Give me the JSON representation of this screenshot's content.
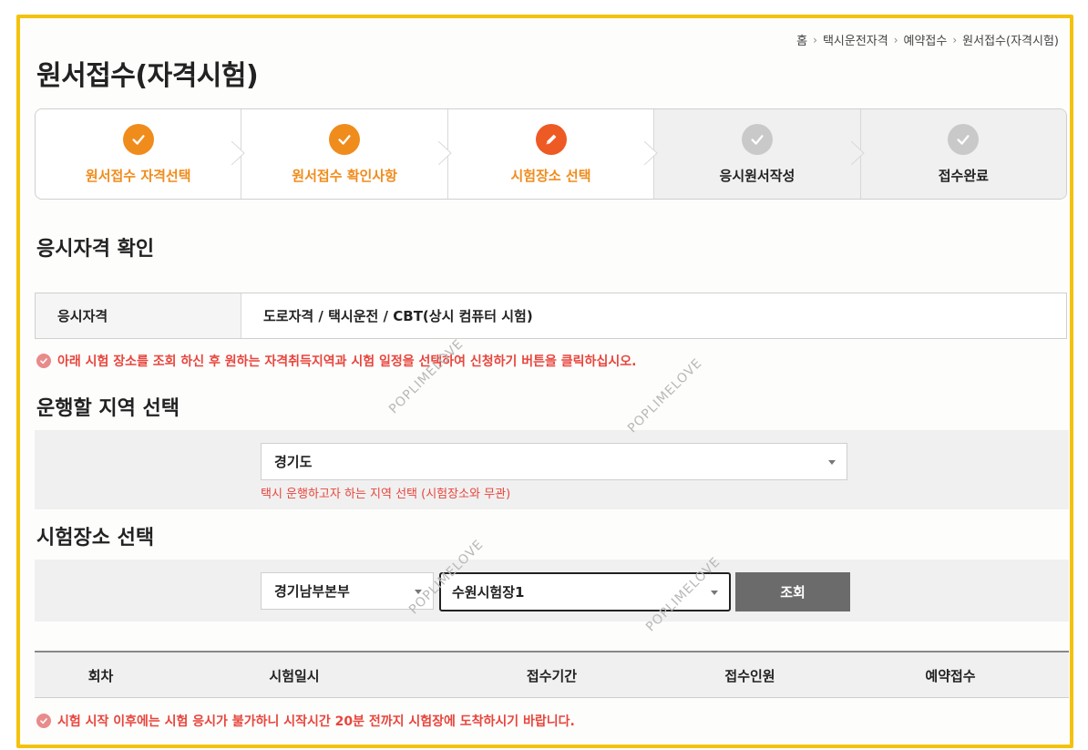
{
  "breadcrumb": [
    "홈",
    "택시운전자격",
    "예약접수",
    "원서접수(자격시험)"
  ],
  "page_title": "원서접수(자격시험)",
  "steps": [
    {
      "label": "원서접수 자격선택",
      "state": "done",
      "icon": "check-icon"
    },
    {
      "label": "원서접수 확인사항",
      "state": "done",
      "icon": "check-icon"
    },
    {
      "label": "시험장소 선택",
      "state": "current",
      "icon": "pencil-icon"
    },
    {
      "label": "응시원서작성",
      "state": "pending",
      "icon": "check-icon"
    },
    {
      "label": "접수완료",
      "state": "pending",
      "icon": "check-icon"
    }
  ],
  "qualification": {
    "section_title": "응시자격 확인",
    "header": "응시자격",
    "value": "도로자격 / 택시운전 / CBT(상시 컴퓨터 시험)"
  },
  "notice_1": "아래 시험 장소를 조회 하신 후 원하는 자격취득지역과 시험 일정을 선택하여 신청하기 버튼을 클릭하십시오.",
  "region": {
    "section_title": "운행할 지역 선택",
    "selected": "경기도",
    "help": "택시 운행하고자 하는 지역 선택 (시험장소와 무관)"
  },
  "venue": {
    "section_title": "시험장소 선택",
    "hq_selected": "경기남부본부",
    "venue_selected": "수원시험장1",
    "search_label": "조회"
  },
  "results_table": {
    "columns": [
      "회차",
      "시험일시",
      "접수기간",
      "접수인원",
      "예약접수"
    ]
  },
  "notice_2": "시험 시작 이후에는 시험 응시가 불가하니 시작시간 20분 전까지 시험장에 도착하시기 바랍니다.",
  "watermark": "POPLIMELOVE",
  "colors": {
    "accent_orange": "#f08c1c",
    "current_step": "#ee5a24",
    "warning_red": "#e8453c",
    "frame_yellow": "#f4c20d",
    "button_gray": "#6b6b6b"
  }
}
